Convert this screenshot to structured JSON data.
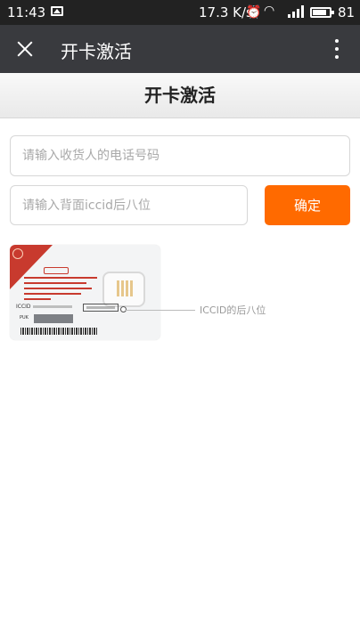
{
  "status_bar": {
    "time": "11:43",
    "network_speed": "17.3 K/s",
    "battery_level": "81",
    "icons": [
      "gallery-icon",
      "alarm-icon",
      "wifi-icon",
      "signal-4g-icon",
      "battery-icon"
    ]
  },
  "app_bar": {
    "title": "开卡激活",
    "close_icon": "close-icon",
    "more_icon": "more-vertical-icon"
  },
  "page": {
    "title": "开卡激活"
  },
  "form": {
    "phone_placeholder": "请输入收货人的电话号码",
    "phone_value": "",
    "iccid_placeholder": "请输入背面iccid后八位",
    "iccid_value": "",
    "confirm_label": "确定"
  },
  "illustration": {
    "sim_iccid_label": "ICCID",
    "sim_puk_label": "PUK",
    "pointer_label": "ICCID的后八位"
  },
  "colors": {
    "status_bar_bg": "#222222",
    "app_bar_bg": "#393a3e",
    "confirm_button": "#ff6a00",
    "sim_accent": "#c83a2e"
  }
}
